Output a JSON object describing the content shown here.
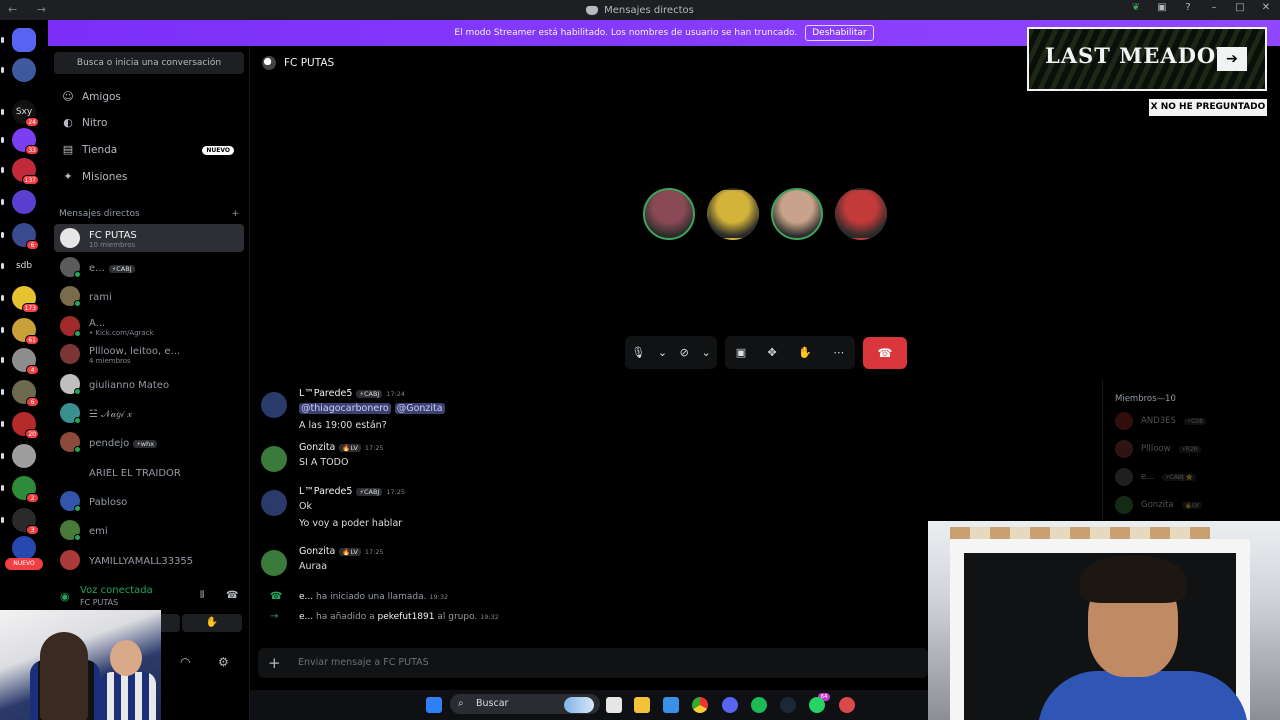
{
  "window": {
    "title": "Mensajes directos",
    "nav_glyphs": "← →",
    "controls": [
      "leaf-icon",
      "screen-icon",
      "help-icon",
      "minimize-icon",
      "maximize-icon",
      "close-icon"
    ]
  },
  "banner": {
    "text": "El modo Streamer está habilitado. Los nombres de usuario se han truncado.",
    "button": "Deshabilitar"
  },
  "rail": {
    "servers": [
      {
        "label": "",
        "badge": "",
        "color": "#5865f2"
      },
      {
        "label": "",
        "badge": "",
        "color": "#3d5a9e"
      },
      {
        "label": "Sxy",
        "badge": "24",
        "color": "#111111"
      },
      {
        "label": "",
        "badge": "33",
        "color": "#7b3ff2"
      },
      {
        "label": "",
        "badge": "137",
        "color": "#c2293b"
      },
      {
        "label": "",
        "badge": "",
        "color": "#5a3fd1"
      },
      {
        "label": "",
        "badge": "6",
        "color": "#3a4a8f"
      },
      {
        "label": "sdb",
        "badge": "",
        "color": "#000000"
      },
      {
        "label": "",
        "badge": "173",
        "color": "#e6c22e"
      },
      {
        "label": "",
        "badge": "61",
        "color": "#c8a038"
      },
      {
        "label": "",
        "badge": "4",
        "color": "#8d8d8d"
      },
      {
        "label": "",
        "badge": "6",
        "color": "#6e6a50"
      },
      {
        "label": "",
        "badge": "20",
        "color": "#b52a2a"
      },
      {
        "label": "",
        "badge": "",
        "color": "#9e9e9e"
      },
      {
        "label": "",
        "badge": "2",
        "color": "#2e8b3a"
      },
      {
        "label": "",
        "badge": "3",
        "color": "#2a2a2a"
      },
      {
        "label": "",
        "badge": "",
        "color": "#2648b0"
      }
    ],
    "new_label": "NUEVO"
  },
  "dm_sidebar": {
    "search_placeholder": "Busca o inicia una conversación",
    "nav": [
      {
        "label": "Amigos",
        "icon": "friends-icon",
        "glyph": "☺"
      },
      {
        "label": "Nitro",
        "icon": "nitro-icon",
        "glyph": "◐"
      },
      {
        "label": "Tienda",
        "icon": "shop-icon",
        "glyph": "▤",
        "badge": "NUEVO"
      },
      {
        "label": "Misiones",
        "icon": "quests-icon",
        "glyph": "✦"
      }
    ],
    "section_title": "Mensajes directos",
    "add_glyph": "+",
    "dms": [
      {
        "name": "FC PUTAS",
        "sub": "10 miembros",
        "tag": "",
        "color": "#e6e6e6",
        "online": false,
        "active": true
      },
      {
        "name": "e...",
        "sub": "",
        "tag": "⚡CABJ",
        "color": "#5b5b5b",
        "online": true
      },
      {
        "name": "rami",
        "sub": "",
        "tag": "",
        "color": "#7a6b4a",
        "online": true
      },
      {
        "name": "A...",
        "sub": "• Kick.com/Agrack",
        "tag": "",
        "color": "#a02a2a",
        "online": true
      },
      {
        "name": "Pllloow, leitoo, e...",
        "sub": "4 miembros",
        "tag": "",
        "color": "#7a3535",
        "online": false
      },
      {
        "name": "giulianno Mateo",
        "sub": "",
        "tag": "",
        "color": "#bfbfbf",
        "online": true
      },
      {
        "name": "☱ 𝒩𝒶𝑔𝒾 𝓍",
        "sub": "",
        "tag": "",
        "color": "#3a8f8f",
        "online": true
      },
      {
        "name": "pendejo",
        "sub": "",
        "tag": "⚡whx",
        "color": "#8b4a3a",
        "online": true
      },
      {
        "name": "ARIEL EL TRAIDOR",
        "sub": "",
        "tag": "",
        "color": "#000000",
        "online": false
      },
      {
        "name": "Pabloso",
        "sub": "",
        "tag": "",
        "color": "#3355aa",
        "online": true
      },
      {
        "name": "emi",
        "sub": "",
        "tag": "",
        "color": "#4a7a3a",
        "online": true
      },
      {
        "name": "YAMILLYAMALL33355",
        "sub": "",
        "tag": "",
        "color": "#aa3a3a",
        "online": false
      }
    ],
    "voice": {
      "status": "Voz conectada",
      "channel": "FC PUTAS"
    }
  },
  "channel": {
    "name": "FC PUTAS"
  },
  "call": {
    "participants": [
      {
        "name": "participant-1",
        "color": "#8a4a55",
        "speaking": true
      },
      {
        "name": "participant-2",
        "color": "#d4b33a",
        "speaking": false
      },
      {
        "name": "participant-3",
        "color": "#c8a28a",
        "speaking": true
      },
      {
        "name": "participant-4",
        "color": "#c23a3a",
        "speaking": false
      }
    ]
  },
  "messages": [
    {
      "author": "L™Parede5",
      "tag": "⚡CABJ",
      "time": "17:24",
      "mentions": [
        "@thiagocarbonero",
        "@Gonzita"
      ],
      "lines": [
        "A las 19:00 están?"
      ],
      "color": "#2a3a6a"
    },
    {
      "author": "Gonzita",
      "tag": "🔥LV",
      "time": "17:25",
      "mentions": [],
      "lines": [
        "SI A TODO"
      ],
      "color": "#3a7a3a"
    },
    {
      "author": "L™Parede5",
      "tag": "⚡CABJ",
      "time": "17:25",
      "mentions": [],
      "lines": [
        "Ok",
        "Yo voy a poder hablar"
      ],
      "color": "#2a3a6a"
    },
    {
      "author": "Gonzita",
      "tag": "🔥LV",
      "time": "17:25",
      "mentions": [],
      "lines": [
        "Auraa"
      ],
      "color": "#3a7a3a"
    }
  ],
  "system_messages": [
    {
      "actor": "e...",
      "text": "ha iniciado una llamada.",
      "target": "",
      "suffix": "",
      "time": "19:32",
      "icon": "phone-icon"
    },
    {
      "actor": "e...",
      "text": "ha añadido a",
      "target": "pekefut1891",
      "suffix": "al grupo.",
      "time": "19:32",
      "icon": "arrow-right-icon"
    }
  ],
  "composer": {
    "placeholder": "Enviar mensaje a FC PUTAS"
  },
  "members": {
    "header": "Miembros—10",
    "list": [
      {
        "name": "AND3ES",
        "tag": "⚡C08",
        "color": "#8a2a2a"
      },
      {
        "name": "Pllloow",
        "tag": "⚡R2R",
        "color": "#8a3a3a"
      },
      {
        "name": "e...",
        "tag": "⚡CABJ ⭐",
        "color": "#5b5b5b"
      },
      {
        "name": "Gonzita",
        "tag": "🔥LV",
        "color": "#3a7a3a"
      }
    ]
  },
  "overlays": {
    "last_meadow": "LAST MEADOW",
    "no_he": "X NO HE PREGUNTADO"
  },
  "taskbar": {
    "search_label": "Buscar",
    "discord_badge": "84"
  }
}
